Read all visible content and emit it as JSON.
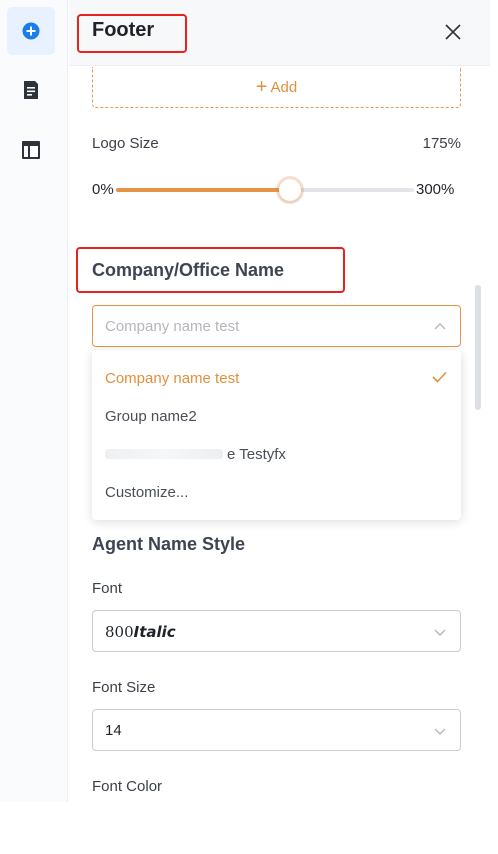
{
  "panel": {
    "title": "Footer",
    "add_label": "Add"
  },
  "logo_size": {
    "label": "Logo Size",
    "value_text": "175%",
    "min_label": "0%",
    "max_label": "300%",
    "value": 175,
    "min": 0,
    "max": 300
  },
  "company": {
    "section_title": "Company/Office Name",
    "placeholder": "Company name test",
    "options": [
      {
        "label": "Company name test",
        "selected": true
      },
      {
        "label": "Group name2",
        "selected": false
      },
      {
        "label": "e Testyfx",
        "selected": false,
        "redacted_prefix": true
      },
      {
        "label": "Customize...",
        "selected": false
      }
    ]
  },
  "agent": {
    "section_title": "Agent Name Style",
    "font_label": "Font",
    "font_value_prefix": "800",
    "font_value_style": "Italic",
    "font_size_label": "Font Size",
    "font_size_value": "14",
    "font_color_label": "Font Color"
  },
  "colors": {
    "accent": "#e59447",
    "highlight_box": "#e8231e",
    "rail_active": "#1a7ee8"
  },
  "icons": {
    "rail": [
      "add-circle-icon",
      "document-icon",
      "layout-icon"
    ],
    "close": "close-icon",
    "chevron_up": "chevron-up-icon",
    "chevron_down": "chevron-down-icon",
    "check": "check-icon"
  }
}
